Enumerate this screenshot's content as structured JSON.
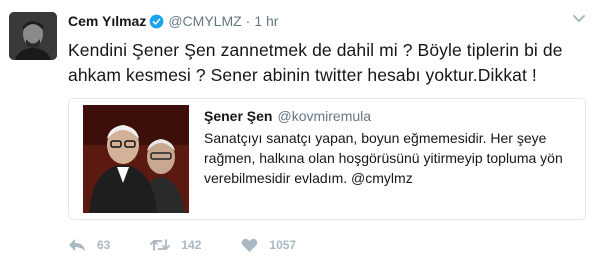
{
  "tweet": {
    "author": {
      "name": "Cem Yılmaz",
      "handle": "@CMYLMZ",
      "verified_icon": "verified-badge-icon",
      "avatar": "user-avatar"
    },
    "separator": "·",
    "time": "1 hr",
    "text": "Kendini Şener Şen zannetmek de dahil mi ? Böyle tiplerin bi de ahkam kesmesi ? Sener abinin twitter hesabı yoktur.Dikkat !",
    "more_icon": "chevron-down-icon",
    "quoted": {
      "name": "Şener Şen",
      "handle": "@kovmiremula",
      "image": "quoted-photo",
      "text": "Sanatçıyı sanatçı yapan, boyun eğmemesidir. Her şeye rağmen, halkına olan hoşgörüsünü yitirmeyip topluma yön verebilmesidir evladım. @cmylmz"
    },
    "actions": {
      "reply": {
        "icon": "reply-icon",
        "count": "63"
      },
      "retweet": {
        "icon": "retweet-icon",
        "count": "142"
      },
      "like": {
        "icon": "heart-icon",
        "count": "1057"
      }
    },
    "colors": {
      "verified": "#1da1f2",
      "meta": "#657786",
      "action": "#aab8c2",
      "border": "#e1e8ed"
    }
  }
}
